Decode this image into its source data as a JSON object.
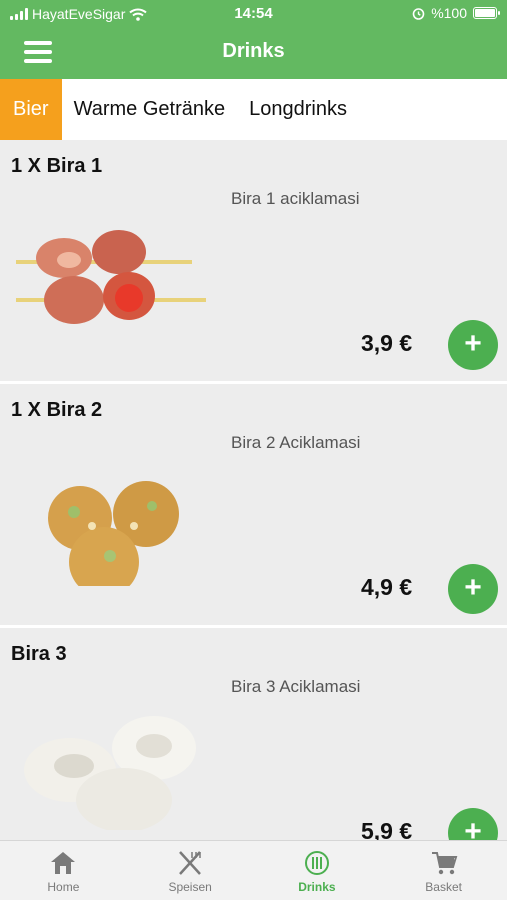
{
  "status_bar": {
    "carrier": "HayatEveSigar",
    "time": "14:54",
    "battery": "%100"
  },
  "header": {
    "title": "Drinks",
    "menu_icon": "hamburger-menu-icon",
    "color": "#63b961"
  },
  "tabs": [
    {
      "label": "Bier",
      "active": true
    },
    {
      "label": "Warme Getränke",
      "active": false
    },
    {
      "label": "Longdrinks",
      "active": false
    }
  ],
  "accent_tab_color": "#f5a01d",
  "products": [
    {
      "name": "1 X Bira 1",
      "description": "Bira 1 aciklamasi",
      "price": "3,9 €",
      "add_label": "+"
    },
    {
      "name": "1 X Bira 2",
      "description": "Bira 2 Aciklamasi",
      "price": "4,9 €",
      "add_label": "+"
    },
    {
      "name": "Bira 3",
      "description": "Bira 3 Aciklamasi",
      "price": "5,9 €",
      "add_label": "+"
    }
  ],
  "bottom_nav": [
    {
      "label": "Home",
      "icon": "home-icon",
      "active": false
    },
    {
      "label": "Speisen",
      "icon": "fork-knife-icon",
      "active": false
    },
    {
      "label": "Drinks",
      "icon": "drinks-icon",
      "active": true
    },
    {
      "label": "Basket",
      "icon": "cart-icon",
      "active": false
    }
  ]
}
